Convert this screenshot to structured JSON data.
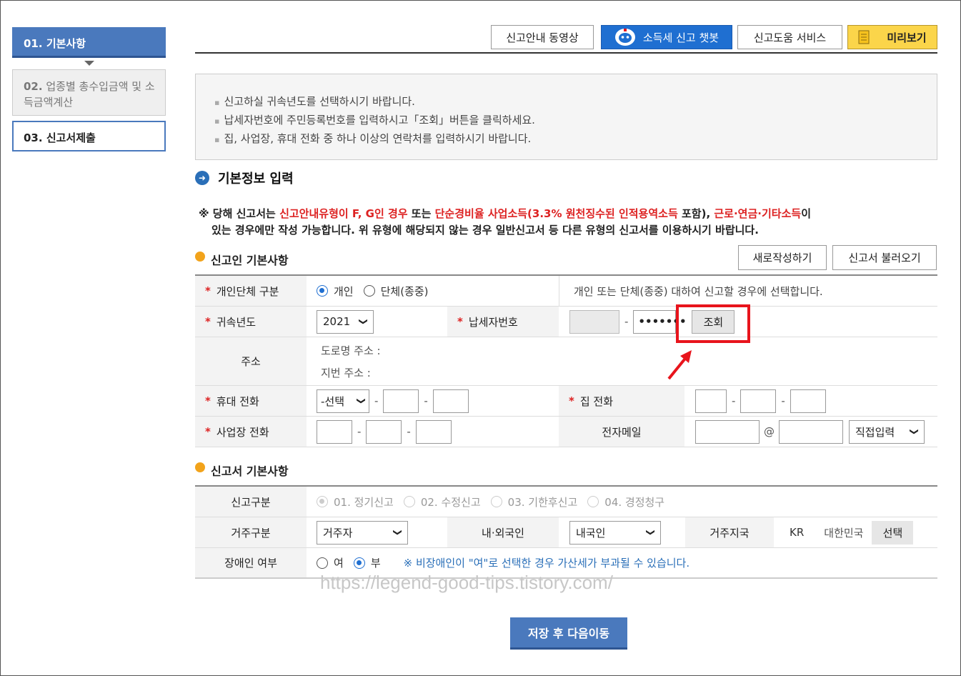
{
  "sidebar": {
    "step1": {
      "num": "01.",
      "label": "기본사항"
    },
    "step2": {
      "num": "02.",
      "label": "업종별 총수입금액 및 소득금액계산"
    },
    "step3": {
      "num": "03.",
      "label": "신고서제출"
    }
  },
  "toolbar": {
    "video": "신고안내 동영상",
    "chatbot": "소득세 신고 챗봇",
    "help": "신고도움 서비스",
    "preview": "미리보기"
  },
  "info": {
    "items": [
      "신고하실 귀속년도를 선택하시기 바랍니다.",
      "납세자번호에 주민등록번호를 입력하시고「조회」버튼을 클릭하세요.",
      "집, 사업장, 휴대 전화 중 하나 이상의 연락처를 입력하시기 바랍니다."
    ]
  },
  "section_title": "기본정보 입력",
  "notice": {
    "p1": "※ 당해 신고서는 ",
    "r1": "신고안내유형이 F, G인 경우",
    "p2": " 또는 ",
    "r2": "단순경비율 사업소득(3.3% 원천징수된 인적용역소득",
    "p3": " 포함), ",
    "r3": "근로·연금·기타소득",
    "p4": "이",
    "line2": "있는 경우에만 작성 가능합니다. 위 유형에 해당되지 않는 경우 일반신고서 등 다른 유형의 신고서를 이용하시기 바랍니다."
  },
  "filer": {
    "title": "신고인 기본사항",
    "new_btn": "새로작성하기",
    "load_btn": "신고서 불러오기",
    "type_label": "개인단체 구분",
    "type_opt1": "개인",
    "type_opt2": "단체(종중)",
    "type_desc": "개인 또는 단체(종중) 대하여 신고할 경우에 선택합니다.",
    "year_label": "귀속년도",
    "year_value": "2021",
    "taxid_label": "납세자번호",
    "taxid_masked": "•••••••",
    "lookup_btn": "조회",
    "addr_label": "주소",
    "road_addr": "도로명 주소 :",
    "lot_addr": "지번 주소 :",
    "mobile_label": "휴대 전화",
    "mobile_select": "-선택",
    "home_label": "집 전화",
    "biz_label": "사업장 전화",
    "email_label": "전자메일",
    "email_at": "@",
    "email_select": "직접입력"
  },
  "report": {
    "title": "신고서 기본사항",
    "kind_label": "신고구분",
    "kind_opts": [
      "01. 정기신고",
      "02. 수정신고",
      "03. 기한후신고",
      "04. 경정청구"
    ],
    "resident_label": "거주구분",
    "resident_value": "거주자",
    "national_label": "내·외국인",
    "national_value": "내국인",
    "region_label": "거주지국",
    "region_code": "KR",
    "region_name": "대한민국",
    "region_btn": "선택",
    "disabled_label": "장애인 여부",
    "disabled_yes": "여",
    "disabled_no": "부",
    "disabled_note": "※ 비장애인이 \"여\"로 선택한 경우 가산세가 부과될 수 있습니다."
  },
  "watermark": "https://legend-good-tips.tistory.com/",
  "save_btn": "저장 후 다음이동",
  "colors": {
    "primary": "#4a79bd",
    "chatbot": "#1f6fd1",
    "highlight": "#e8141c",
    "preview": "#fbd54a"
  }
}
